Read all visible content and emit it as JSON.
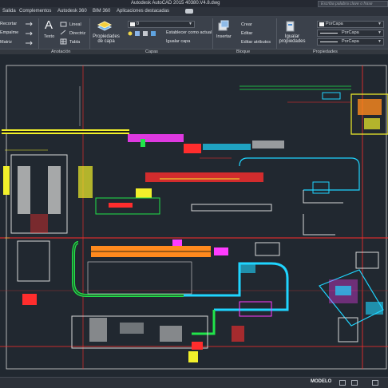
{
  "window": {
    "title": "Autodesk AutoCAD 2015   40380.V4.8.dwg",
    "search_placeholder": "Escriba palabra clave o frase"
  },
  "ribbon_tabs": [
    "Salida",
    "Complementos",
    "Autodesk 360",
    "BIM 360",
    "Aplicaciones destacadas"
  ],
  "ribbon": {
    "modify": {
      "recortar": "Recortar",
      "empalme": "Empalme",
      "matriz": "Matriz"
    },
    "annotation": {
      "texto": "Texto",
      "texto_glyph": "A",
      "lineal": "Lineal",
      "directriz": "Directriz",
      "tabla": "Tabla",
      "panel": "Anotación"
    },
    "layers": {
      "properties_line1": "Propiedades",
      "properties_line2": "de capa",
      "current_layer": "0",
      "establecer": "Establecer como actual",
      "igualar_capa": "Igualar capa",
      "panel": "Capas"
    },
    "block": {
      "insertar": "Insertar",
      "crear": "Crear",
      "editar": "Editar",
      "editar_atributos": "Editar atributos",
      "panel": "Bloque"
    },
    "properties": {
      "igualar_line1": "Igualar",
      "igualar_line2": "propiedades",
      "color": "PorCapa",
      "linetype": "PorCapa",
      "lineweight": "PorCapa",
      "panel": "Propiedades"
    }
  },
  "status": {
    "model_tab": "MODELO"
  },
  "colors": {
    "canvas": "#212830",
    "ribbon": "#3b414b",
    "accent_red": "#ff2d2d",
    "cad_cyan": "#1fd5ff",
    "cad_green": "#21e44a",
    "cad_yellow": "#f2f02b",
    "cad_magenta": "#ff3cff",
    "cad_orange": "#ff8a1e"
  },
  "icons": {
    "statusbar": [
      "grid-icon",
      "snap-icon",
      "ortho-icon"
    ]
  }
}
